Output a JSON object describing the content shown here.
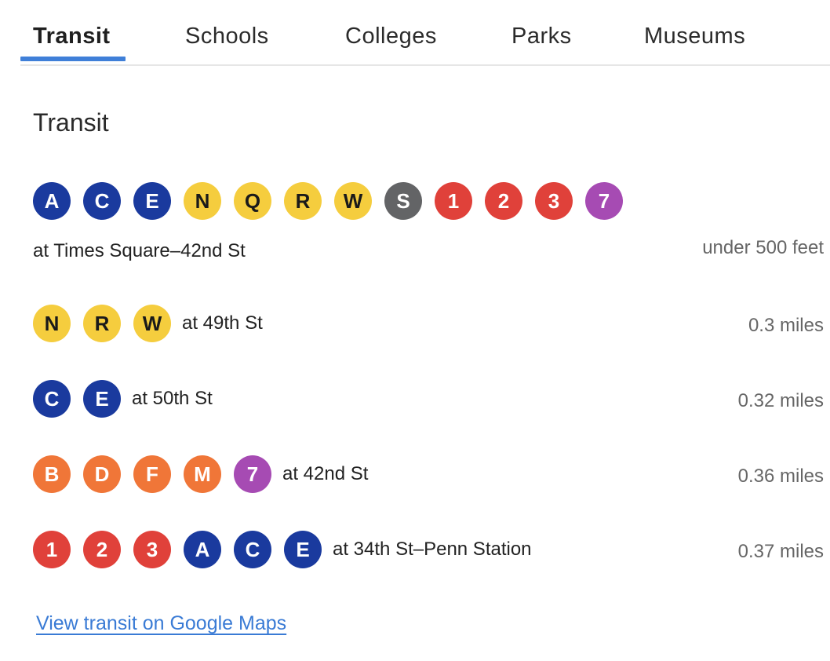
{
  "tabs": [
    {
      "label": "Transit",
      "active": true
    },
    {
      "label": "Schools",
      "active": false
    },
    {
      "label": "Colleges",
      "active": false
    },
    {
      "label": "Parks",
      "active": false
    },
    {
      "label": "Museums",
      "active": false
    }
  ],
  "section_title": "Transit",
  "line_colors": {
    "blue": "#1a3a9e",
    "yellow": "#f5cd3e",
    "gray": "#636466",
    "red": "#e0413a",
    "purple": "#a64bb3",
    "orange": "#f07638"
  },
  "stations": [
    {
      "lines": [
        "A",
        "C",
        "E",
        "N",
        "Q",
        "R",
        "W",
        "S",
        "1",
        "2",
        "3",
        "7"
      ],
      "name": "at Times Square–42nd St",
      "distance": "under 500 feet"
    },
    {
      "lines": [
        "N",
        "R",
        "W"
      ],
      "name": "at 49th St",
      "distance": "0.3 miles"
    },
    {
      "lines": [
        "C",
        "E"
      ],
      "name": "at 50th St",
      "distance": "0.32 miles"
    },
    {
      "lines": [
        "B",
        "D",
        "F",
        "M",
        "7"
      ],
      "name": "at 42nd St",
      "distance": "0.36 miles"
    },
    {
      "lines": [
        "1",
        "2",
        "3",
        "A",
        "C",
        "E"
      ],
      "name": "at 34th St–Penn Station",
      "distance": "0.37 miles"
    }
  ],
  "maps_link": "View transit on Google Maps"
}
